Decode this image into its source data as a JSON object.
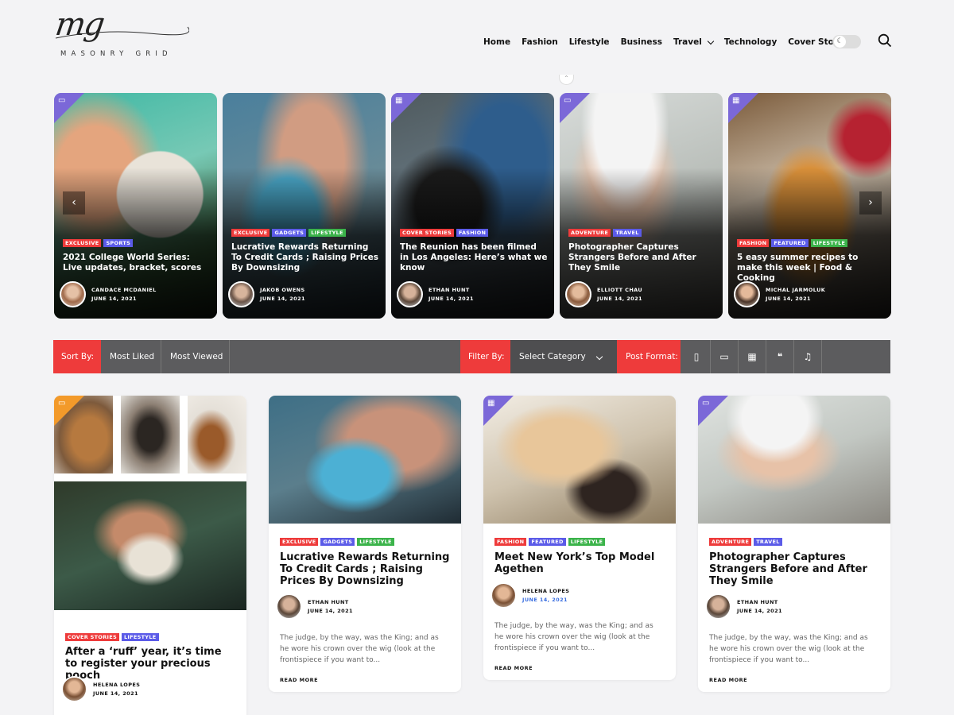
{
  "brand": {
    "logo_text": "mg",
    "tagline": "MASONRY GRID"
  },
  "nav": {
    "items": [
      "Home",
      "Fashion",
      "Lifestyle",
      "Business",
      "Travel",
      "Technology",
      "Cover Stories"
    ]
  },
  "colors": {
    "accent_red": "#ee3b3b",
    "tag_blue": "#5b5be8",
    "tag_green": "#3bb34a",
    "corner_purple": "#7b68d8",
    "corner_orange": "#f39a2a",
    "bar_gray": "#5c5c5e"
  },
  "icons": {
    "theme_toggle": "moon-icon",
    "search": "search-icon",
    "format_gallery": "gallery-icon",
    "format_video": "film-icon"
  },
  "slider": [
    {
      "tags": [
        {
          "t": "EXCLUSIVE",
          "c": "red"
        },
        {
          "t": "SPORTS",
          "c": "blue"
        }
      ],
      "title": "2021 College World Series: Live updates, bracket, scores",
      "author": "CANDACE MCDANIEL",
      "date": "JUNE 14, 2021"
    },
    {
      "tags": [
        {
          "t": "EXCLUSIVE",
          "c": "red"
        },
        {
          "t": "GADGETS",
          "c": "blue"
        },
        {
          "t": "LIFESTYLE",
          "c": "green"
        }
      ],
      "title": "Lucrative Rewards Returning To Credit Cards ; Raising Prices By Downsizing",
      "author": "JAKOB OWENS",
      "date": "JUNE 14, 2021"
    },
    {
      "tags": [
        {
          "t": "COVER STORIES",
          "c": "red"
        },
        {
          "t": "FASHION",
          "c": "blue"
        }
      ],
      "title": "The Reunion has been filmed in Los Angeles: Here’s what we know",
      "author": "ETHAN HUNT",
      "date": "JUNE 14, 2021"
    },
    {
      "tags": [
        {
          "t": "ADVENTURE",
          "c": "red"
        },
        {
          "t": "TRAVEL",
          "c": "blue"
        }
      ],
      "title": "Photographer Captures Strangers Before and After They Smile",
      "author": "ELLIOTT CHAU",
      "date": "JUNE 14, 2021"
    },
    {
      "tags": [
        {
          "t": "FASHION",
          "c": "red"
        },
        {
          "t": "FEATURED",
          "c": "blue"
        },
        {
          "t": "LIFESTYLE",
          "c": "green"
        }
      ],
      "title": "5 easy summer recipes to make this week | Food & Cooking",
      "author": "MICHAL JARMOLUK",
      "date": "JUNE 14, 2021"
    }
  ],
  "filter_bar": {
    "sort_label": "Sort By:",
    "most_liked": "Most Liked",
    "most_viewed": "Most Viewed",
    "filter_label": "Filter By:",
    "select_category": "Select Category",
    "post_format_label": "Post Format:"
  },
  "grid": [
    {
      "tags": [
        {
          "t": "COVER STORIES",
          "c": "red"
        },
        {
          "t": "LIFESTYLE",
          "c": "blue"
        }
      ],
      "title": "After a ‘ruff’ year, it’s time to register your precious pooch",
      "author": "HELENA LOPES",
      "date": "JUNE 14, 2021"
    },
    {
      "tags": [
        {
          "t": "EXCLUSIVE",
          "c": "red"
        },
        {
          "t": "GADGETS",
          "c": "blue"
        },
        {
          "t": "LIFESTYLE",
          "c": "green"
        }
      ],
      "title": "Lucrative Rewards Returning To Credit Cards ; Raising Prices By Downsizing",
      "author": "ETHAN HUNT",
      "date": "JUNE 14, 2021",
      "excerpt": "The judge, by the way, was the King; and as he wore his crown over the wig (look at the frontispiece if you want to...",
      "more": "READ MORE"
    },
    {
      "tags": [
        {
          "t": "FASHION",
          "c": "red"
        },
        {
          "t": "FEATURED",
          "c": "blue"
        },
        {
          "t": "LIFESTYLE",
          "c": "green"
        }
      ],
      "title": "Meet New York’s Top Model Agethen",
      "author": "HELENA LOPES",
      "date": "JUNE 14, 2021",
      "excerpt": "The judge, by the way, was the King; and as he wore his crown over the wig (look at the frontispiece if you want to...",
      "more": "READ MORE"
    },
    {
      "tags": [
        {
          "t": "ADVENTURE",
          "c": "red"
        },
        {
          "t": "TRAVEL",
          "c": "blue"
        }
      ],
      "title": "Photographer Captures Strangers Before and After They Smile",
      "author": "ETHAN HUNT",
      "date": "JUNE 14, 2021",
      "excerpt": "The judge, by the way, was the King; and as he wore his crown over the wig (look at the frontispiece if you want to...",
      "more": "READ MORE"
    }
  ]
}
